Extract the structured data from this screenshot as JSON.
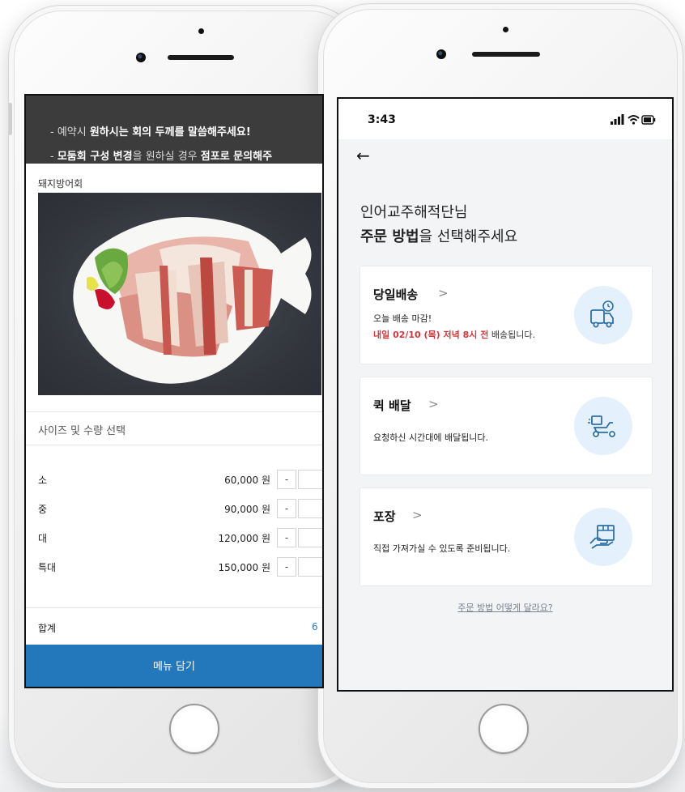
{
  "left_screen": {
    "notice_lines": [
      {
        "pre": "- 예약시 ",
        "bold": "원하시는 회의 두께를 말씀해주세요!",
        "post": ""
      },
      {
        "pre": "- ",
        "bold": "모둠회 구성 변경",
        "post": "을 원하실 경우 ",
        "bold2": "점포로 문의해주"
      }
    ],
    "product_title": "돼지방어회",
    "section_title": "사이즈 및 수량 선택",
    "sizes": [
      {
        "name": "소",
        "price": "60,000 원"
      },
      {
        "name": "중",
        "price": "90,000 원"
      },
      {
        "name": "대",
        "price": "120,000 원"
      },
      {
        "name": "특대",
        "price": "150,000 원"
      }
    ],
    "minus_label": "-",
    "total_label": "합계",
    "total_value": "6",
    "cart_button": "메뉴 담기"
  },
  "right_screen": {
    "status_time": "3:43",
    "greeting_name": "인어교주해적단님",
    "greeting_bold": "주문 방법",
    "greeting_rest": "을 선택해주세요",
    "options": [
      {
        "title": "당일배송",
        "chevron": ">",
        "line1": "오늘 배송 마감!",
        "line2_red": "내일 02/10 (목) 저녁 8시 전",
        "line2_rest": " 배송됩니다.",
        "icon": "delivery-truck-clock-icon"
      },
      {
        "title": "퀵 배달",
        "chevron": ">",
        "line1": "요청하신 시간대에 배달됩니다.",
        "icon": "delivery-scooter-icon"
      },
      {
        "title": "포장",
        "chevron": ">",
        "line1": "직접 가져가실 수 있도록 준비됩니다.",
        "icon": "package-hand-icon"
      }
    ],
    "help_link": "주문 방법 어떻게 달라요?"
  },
  "colors": {
    "accent_blue": "#2377bb",
    "highlight_red": "#d2363a",
    "icon_circle_bg": "#e4f0fb"
  }
}
